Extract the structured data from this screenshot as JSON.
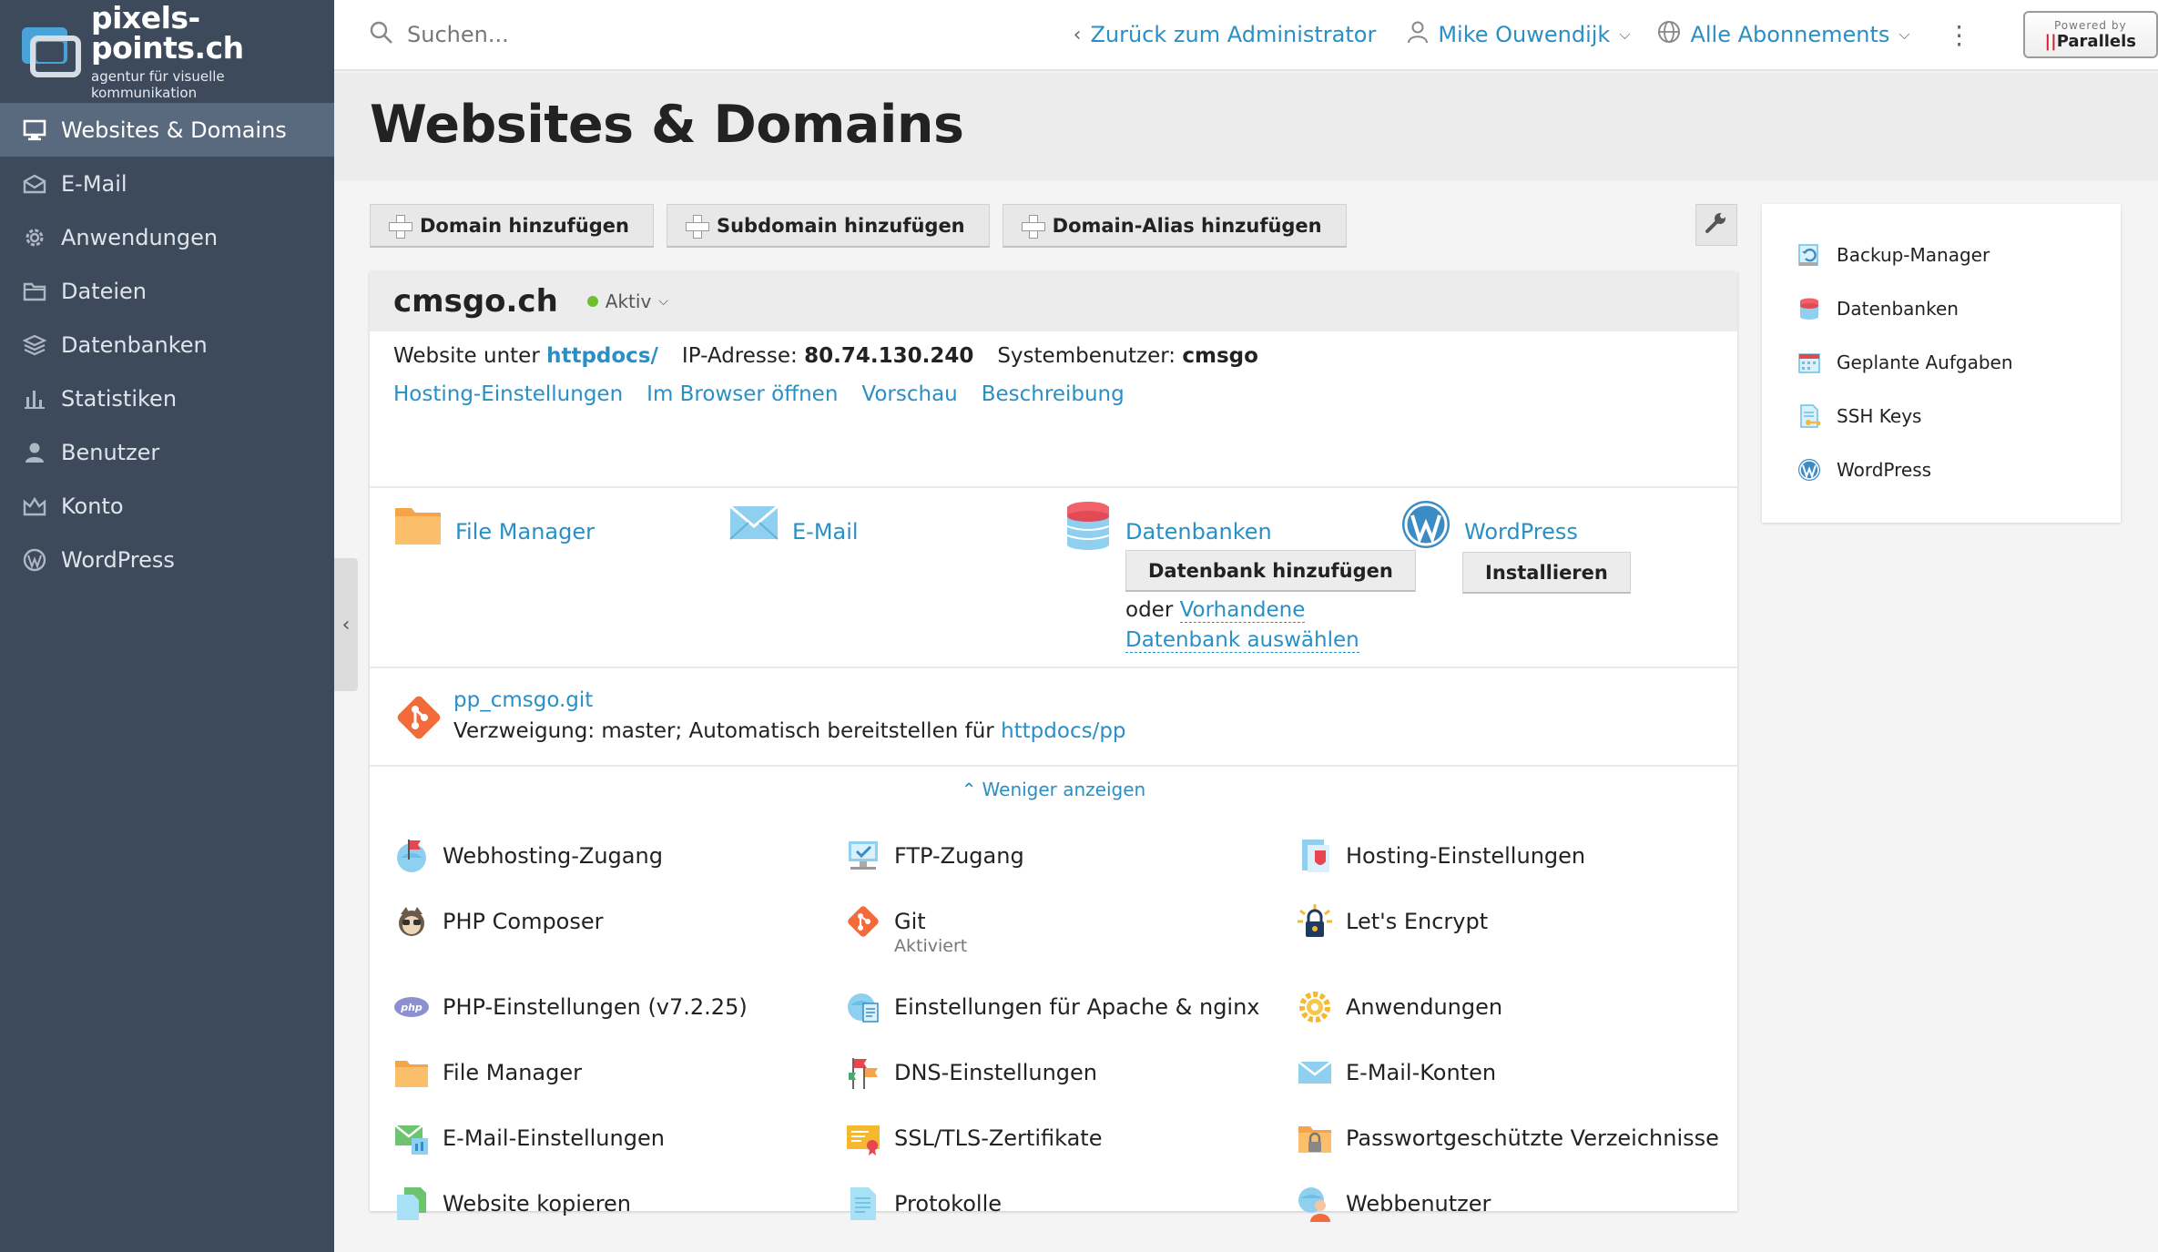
{
  "brand": {
    "title": "pixels-points.ch",
    "subtitle": "agentur für visuelle kommunikation"
  },
  "sidebar": {
    "items": [
      {
        "label": "Websites & Domains",
        "icon": "monitor-icon",
        "active": true
      },
      {
        "label": "E-Mail",
        "icon": "envelope-icon"
      },
      {
        "label": "Anwendungen",
        "icon": "gear-icon"
      },
      {
        "label": "Dateien",
        "icon": "folder-icon"
      },
      {
        "label": "Datenbanken",
        "icon": "layers-icon"
      },
      {
        "label": "Statistiken",
        "icon": "bar-chart-icon"
      },
      {
        "label": "Benutzer",
        "icon": "user-icon"
      },
      {
        "label": "Konto",
        "icon": "crown-icon"
      },
      {
        "label": "WordPress",
        "icon": "wordpress-icon"
      }
    ]
  },
  "topbar": {
    "search_placeholder": "Suchen...",
    "back_label": "Zurück zum Administrator",
    "user_label": "Mike Ouwendijk",
    "subscriptions_label": "Alle Abonnements",
    "powered_by": "Powered by",
    "parallels": "Parallels"
  },
  "page": {
    "title": "Websites & Domains"
  },
  "toolbar": {
    "add_domain": "Domain hinzufügen",
    "add_subdomain": "Subdomain hinzufügen",
    "add_alias": "Domain-Alias hinzufügen"
  },
  "domain": {
    "name": "cmsgo.ch",
    "status": "Aktiv",
    "website_prefix": "Website unter",
    "website_path": "httpdocs/",
    "ip_label": "IP-Adresse:",
    "ip": "80.74.130.240",
    "sysuser_label": "Systembenutzer:",
    "sysuser": "cmsgo",
    "links": [
      "Hosting-Einstellungen",
      "Im Browser öffnen",
      "Vorschau",
      "Beschreibung"
    ]
  },
  "tiles": {
    "file_manager": "File Manager",
    "email": "E-Mail",
    "databases": "Datenbanken",
    "add_db": "Datenbank hinzufügen",
    "or": "oder",
    "existing_db_1": "Vorhandene",
    "existing_db_2": "Datenbank auswählen",
    "wordpress": "WordPress",
    "install": "Installieren"
  },
  "git": {
    "repo": "pp_cmsgo.git",
    "branch_text": "Verzweigung: master; Automatisch bereitstellen für",
    "deploy_path": "httpdocs/pp"
  },
  "less_label": "Weniger anzeigen",
  "tools": [
    {
      "label": "Webhosting-Zugang",
      "icon": "globe-flag-icon"
    },
    {
      "label": "FTP-Zugang",
      "icon": "ftp-monitor-icon"
    },
    {
      "label": "Hosting-Einstellungen",
      "icon": "hosting-settings-icon"
    },
    {
      "label": "PHP Composer",
      "icon": "composer-icon"
    },
    {
      "label": "Git",
      "icon": "git-icon",
      "sub": "Aktiviert"
    },
    {
      "label": "Let's Encrypt",
      "icon": "lock-sun-icon"
    },
    {
      "label": "PHP-Einstellungen (v7.2.25)",
      "icon": "php-icon"
    },
    {
      "label": "Einstellungen für Apache & nginx",
      "icon": "apache-nginx-icon"
    },
    {
      "label": "Anwendungen",
      "icon": "sun-gear-icon"
    },
    {
      "label": "File Manager",
      "icon": "folder-icon"
    },
    {
      "label": "DNS-Einstellungen",
      "icon": "dns-flags-icon"
    },
    {
      "label": "E-Mail-Konten",
      "icon": "envelope-icon"
    },
    {
      "label": "E-Mail-Einstellungen",
      "icon": "mail-settings-icon"
    },
    {
      "label": "SSL/TLS-Zertifikate",
      "icon": "certificate-icon"
    },
    {
      "label": "Passwortgeschützte Verzeichnisse",
      "icon": "locked-folder-icon"
    },
    {
      "label": "Website kopieren",
      "icon": "copy-pages-icon"
    },
    {
      "label": "Protokolle",
      "icon": "log-document-icon"
    },
    {
      "label": "Webbenutzer",
      "icon": "web-user-icon"
    }
  ],
  "side_panel": {
    "items": [
      {
        "label": "Backup-Manager",
        "icon": "backup-icon"
      },
      {
        "label": "Datenbanken",
        "icon": "database-icon"
      },
      {
        "label": "Geplante Aufgaben",
        "icon": "calendar-icon"
      },
      {
        "label": "SSH Keys",
        "icon": "key-document-icon"
      },
      {
        "label": "WordPress",
        "icon": "wordpress-icon"
      }
    ]
  },
  "colors": {
    "sidebar": "#3c4a5c",
    "sidebar_active": "#5a6a7e",
    "link": "#2a8fc5",
    "status_green": "#6fbf2e"
  }
}
